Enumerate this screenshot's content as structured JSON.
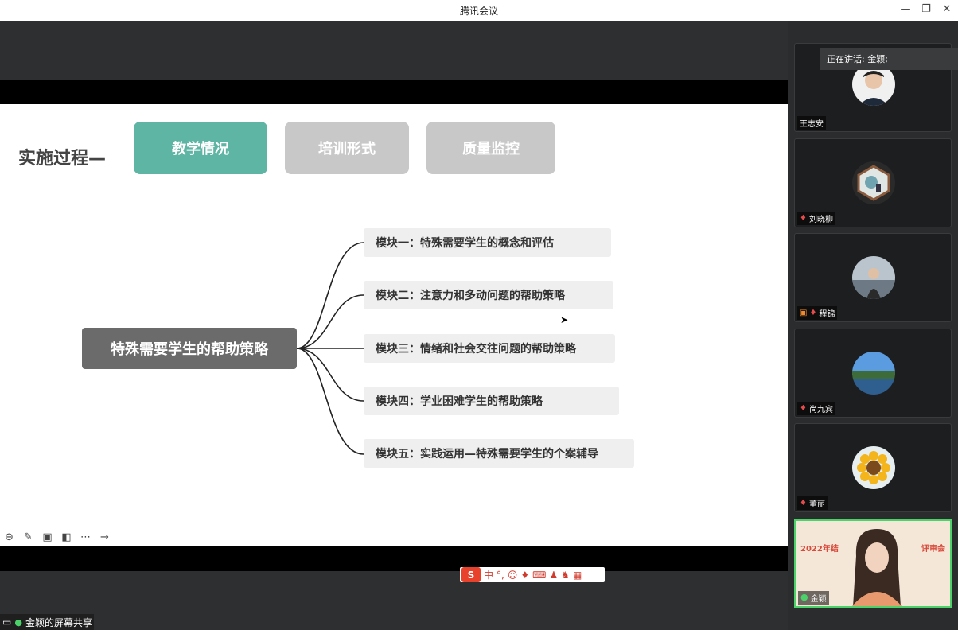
{
  "window": {
    "title": "腾讯会议"
  },
  "slide": {
    "process_label": "实施过程—",
    "tabs": [
      {
        "label": "教学情况",
        "state": "active"
      },
      {
        "label": "培训形式",
        "state": "inactive"
      },
      {
        "label": "质量监控",
        "state": "inactive"
      }
    ],
    "center_node": "特殊需要学生的帮助策略",
    "modules": [
      "模块一：特殊需要学生的概念和评估",
      "模块二：注意力和多动问题的帮助策略",
      "模块三：情绪和社会交往问题的帮助策略",
      "模块四：学业困难学生的帮助策略",
      "模块五：实践运用—特殊需要学生的个案辅导"
    ]
  },
  "share_indicator": {
    "label": "金颖的屏幕共享"
  },
  "ime": {
    "logo": "S",
    "mode": "中"
  },
  "speaking_label": "正在讲话: 金颖;",
  "participants": [
    {
      "name": "王志安",
      "mic": "none"
    },
    {
      "name": "刘晓柳",
      "mic": "muted"
    },
    {
      "name": "程锦",
      "mic": "muted"
    },
    {
      "name": "尚九宾",
      "mic": "muted"
    },
    {
      "name": "董丽",
      "mic": "muted"
    }
  ],
  "self_tile": {
    "name": "金颖",
    "banner_left": "2022年结",
    "banner_right": "评审会"
  },
  "colors": {
    "active_tab": "#5fb5a3",
    "inactive_tab": "#c8c8c8",
    "center_node": "#6b6b6b",
    "module_bg": "#efefef",
    "self_border": "#4bd36a"
  }
}
